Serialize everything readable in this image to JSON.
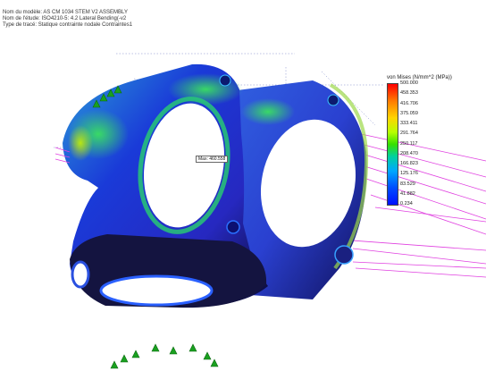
{
  "header": {
    "model_line": "Nom du modèle: AS CM 1034 STEM V2 ASSEMBLY",
    "study_line": "Nom de l'étude: ISO4210-5: 4.2 Lateral Bending(-v2",
    "plot_line": "Type de tracé: Statique contrainte nodale Contraintes1"
  },
  "legend": {
    "title": "von Mises (N/mm^2 (MPa))",
    "ticks": [
      "500.000",
      "458.353",
      "416.706",
      "375.059",
      "333.411",
      "291.764",
      "250.117",
      "208.470",
      "166.823",
      "125.176",
      "83.529",
      "41.882",
      "0.234"
    ]
  },
  "probe": {
    "label": "Max: 460.558"
  },
  "colors": {
    "mesh_blue": "#2032d8",
    "mesh_green": "#2fbf4a",
    "load_arrows": "#e040e0",
    "fixture_arrows": "#1aa020"
  }
}
